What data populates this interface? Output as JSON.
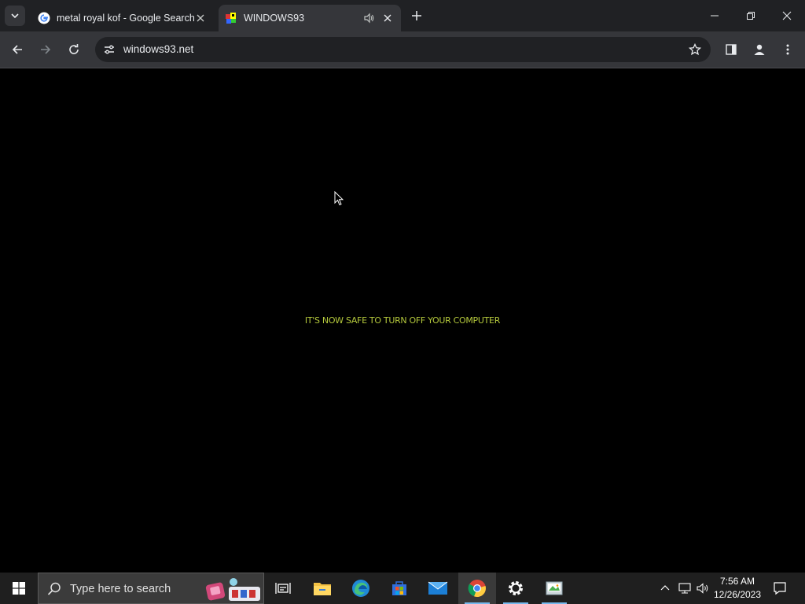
{
  "browser": {
    "tabs": [
      {
        "title": "metal royal kof - Google Search",
        "favicon": "google-g-icon",
        "active": false
      },
      {
        "title": "WINDOWS93",
        "favicon": "windows93-icon",
        "active": true,
        "audio": "speaker-icon"
      }
    ],
    "url": "windows93.net"
  },
  "page": {
    "message": "IT'S NOW SAFE TO TURN OFF YOUR COMPUTER",
    "message_color": "#b4c83c",
    "background": "#000000"
  },
  "taskbar": {
    "search_placeholder": "Type here to search",
    "pinned": [
      "task-view-icon",
      "file-explorer-icon",
      "edge-icon",
      "store-icon",
      "mail-icon",
      "chrome-icon",
      "settings-icon",
      "paint-icon"
    ],
    "time": "7:56 AM",
    "date": "12/26/2023"
  }
}
